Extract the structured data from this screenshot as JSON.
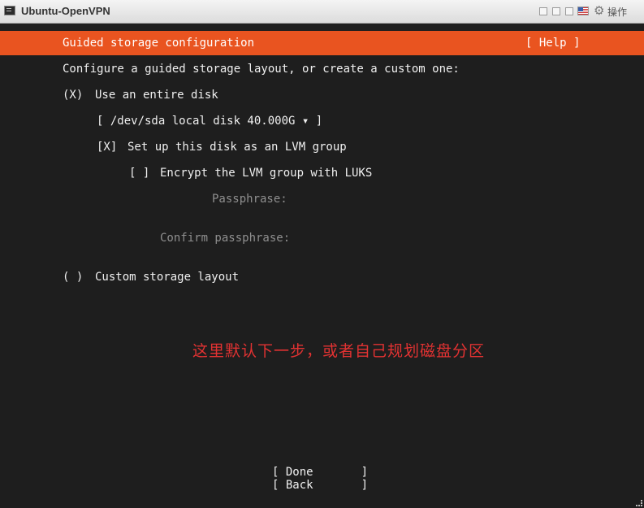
{
  "window": {
    "title": "Ubuntu-OpenVPN",
    "ops_label": "操作",
    "icons": [
      "terminal-app-icon",
      "window-control-icon",
      "window-control-icon",
      "window-control-icon",
      "us-flag-icon",
      "gear-icon"
    ]
  },
  "installer": {
    "header_title": "Guided storage configuration",
    "help_label": "[ Help ]",
    "intro": "Configure a guided storage layout, or create a custom one:",
    "entire_disk": {
      "marker": "(X)",
      "label": "Use an entire disk"
    },
    "disk_select": "[ /dev/sda local disk 40.000G ▾ ]",
    "lvm": {
      "marker": "[X]",
      "label": "Set up this disk as an LVM group"
    },
    "encrypt": {
      "marker": "[ ]",
      "label": "Encrypt the LVM group with LUKS"
    },
    "passphrase_label": "Passphrase:",
    "confirm_passphrase_label": "Confirm passphrase:",
    "custom": {
      "marker": "( )",
      "label": "Custom storage layout"
    },
    "done_button": "[ Done       ]",
    "back_button": "[ Back       ]"
  },
  "annotation": "这里默认下一步，或者自己规划磁盘分区",
  "colors": {
    "accent": "#e95420",
    "background": "#1e1e1e",
    "annotation": "#e23232"
  }
}
